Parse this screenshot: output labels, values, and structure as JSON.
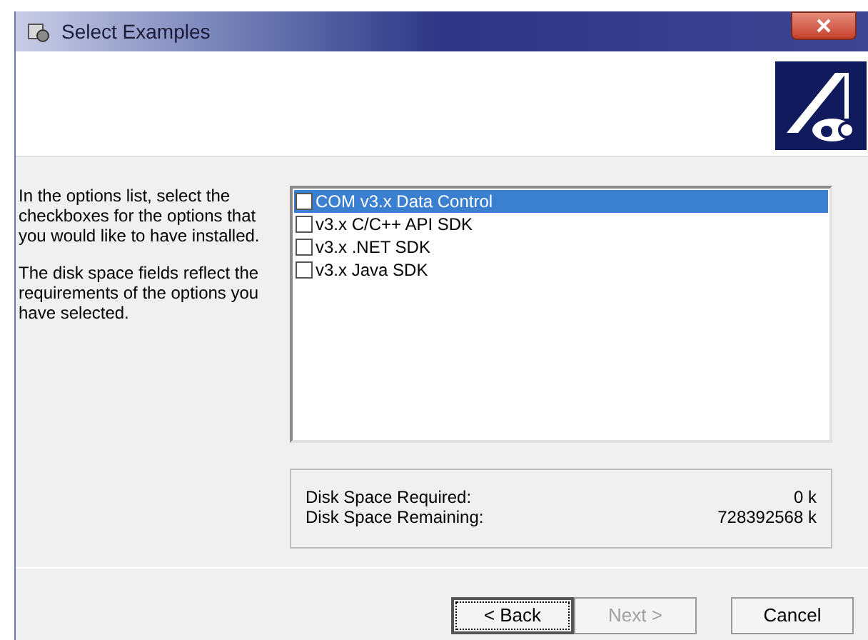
{
  "window": {
    "title": "Select Examples"
  },
  "instructions": [
    "In the options list, select the checkboxes for the options that you would like to have installed.",
    "The disk space fields reflect the requirements of the options you have selected."
  ],
  "options": [
    {
      "label": "COM v3.x Data Control",
      "checked": false,
      "selected": true
    },
    {
      "label": "v3.x C/C++ API SDK",
      "checked": false,
      "selected": false
    },
    {
      "label": "v3.x .NET SDK",
      "checked": false,
      "selected": false
    },
    {
      "label": "v3.x Java SDK",
      "checked": false,
      "selected": false
    }
  ],
  "disk_space": [
    {
      "label": "Disk Space Required:",
      "value": "0 k"
    },
    {
      "label": "Disk Space Remaining:",
      "value": "728392568 k"
    }
  ],
  "buttons": [
    {
      "label": "< Back",
      "disabled": false,
      "default": true
    },
    {
      "label": "Next >",
      "disabled": true,
      "default": false
    },
    {
      "label": "Cancel",
      "disabled": false,
      "default": false
    }
  ]
}
